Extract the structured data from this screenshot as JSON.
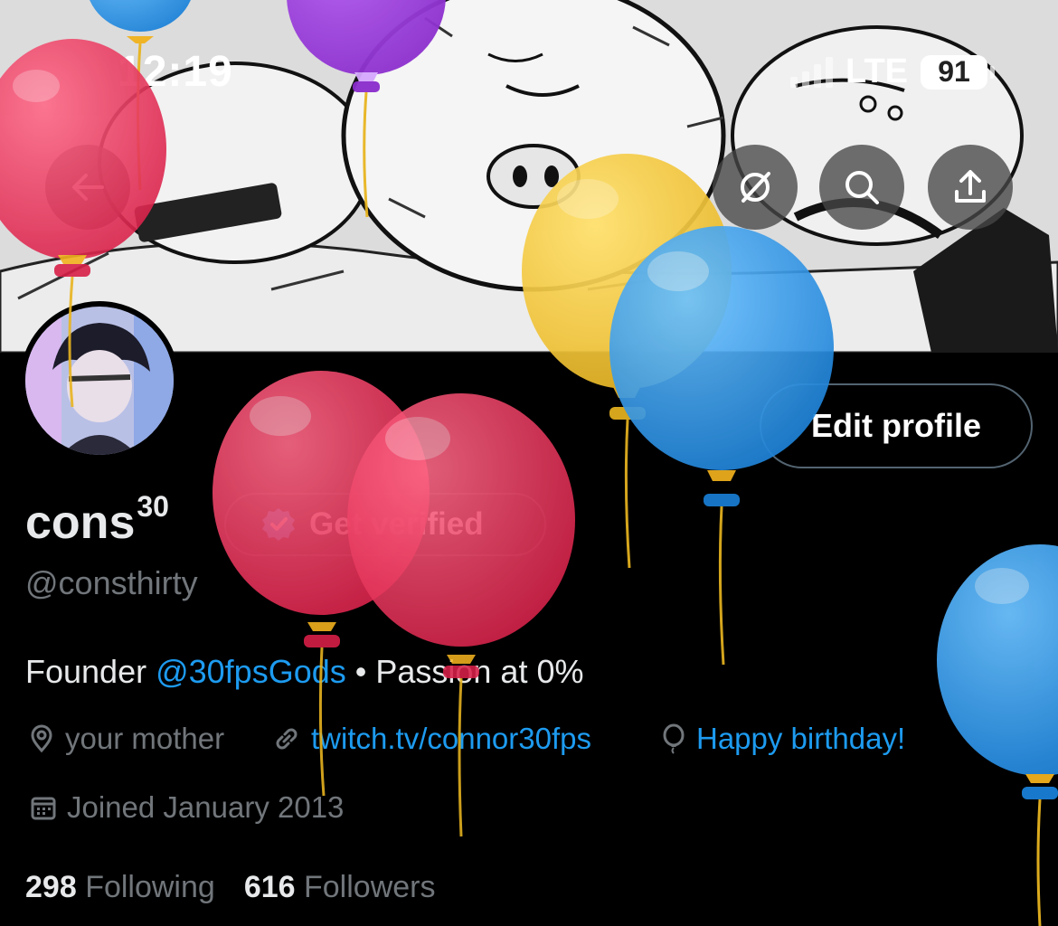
{
  "status_bar": {
    "time": "12:19",
    "network": "LTE",
    "battery": "91"
  },
  "header": {
    "back_icon": "arrow-left-icon",
    "buttons": [
      "circle-slash-icon",
      "search-icon",
      "share-icon"
    ]
  },
  "profile": {
    "edit_label": "Edit profile",
    "name": "cons",
    "name_sup": "30",
    "verify_label": "Get verified",
    "handle": "@consthirty",
    "bio_prefix": "Founder ",
    "bio_mention": "@30fpsGods",
    "bio_suffix": " • Passion at 0%",
    "location": "your mother",
    "website": "twitch.tv/connor30fps",
    "birthday": "Happy birthday!",
    "joined": "Joined January 2013",
    "following_count": "298",
    "following_label": "Following",
    "followers_count": "616",
    "followers_label": "Followers"
  },
  "colors": {
    "accent": "#1d9bf0",
    "muted": "#71767b",
    "balloon_red": "#e8335c",
    "balloon_blue": "#2b8fe0",
    "balloon_yellow": "#f2c230",
    "balloon_purple": "#9b3ad8"
  }
}
